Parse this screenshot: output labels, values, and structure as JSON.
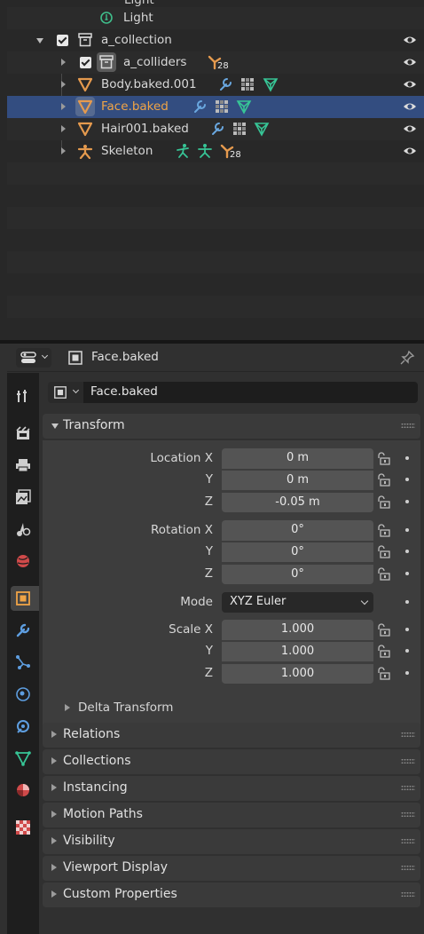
{
  "outliner": {
    "partial_top_label": "Light",
    "light_label": "Light",
    "collection_label": "a_collection",
    "rows": [
      {
        "label": "a_colliders",
        "badge": "28"
      },
      {
        "label": "Body.baked.001"
      },
      {
        "label": "Face.baked"
      },
      {
        "label": "Hair001.baked"
      },
      {
        "label": "Skeleton",
        "badge": "28"
      }
    ]
  },
  "properties": {
    "header_object": "Face.baked",
    "object_name": "Face.baked",
    "transform": {
      "title": "Transform",
      "location_x_label": "Location X",
      "y_label": "Y",
      "z_label": "Z",
      "location": [
        "0 m",
        "0 m",
        "-0.05 m"
      ],
      "rotation_x_label": "Rotation X",
      "rotation": [
        "0°",
        "0°",
        "0°"
      ],
      "mode_label": "Mode",
      "mode_value": "XYZ Euler",
      "scale_x_label": "Scale X",
      "scale": [
        "1.000",
        "1.000",
        "1.000"
      ],
      "delta": "Delta Transform"
    },
    "panels": [
      "Relations",
      "Collections",
      "Instancing",
      "Motion Paths",
      "Visibility",
      "Viewport Display",
      "Custom Properties"
    ]
  },
  "colors": {
    "selected_row": "#334d80",
    "object_orange": "#e59a4e",
    "modifier_blue": "#6aa8e0",
    "data_green": "#37c596",
    "light_green": "#3fbd8b"
  }
}
